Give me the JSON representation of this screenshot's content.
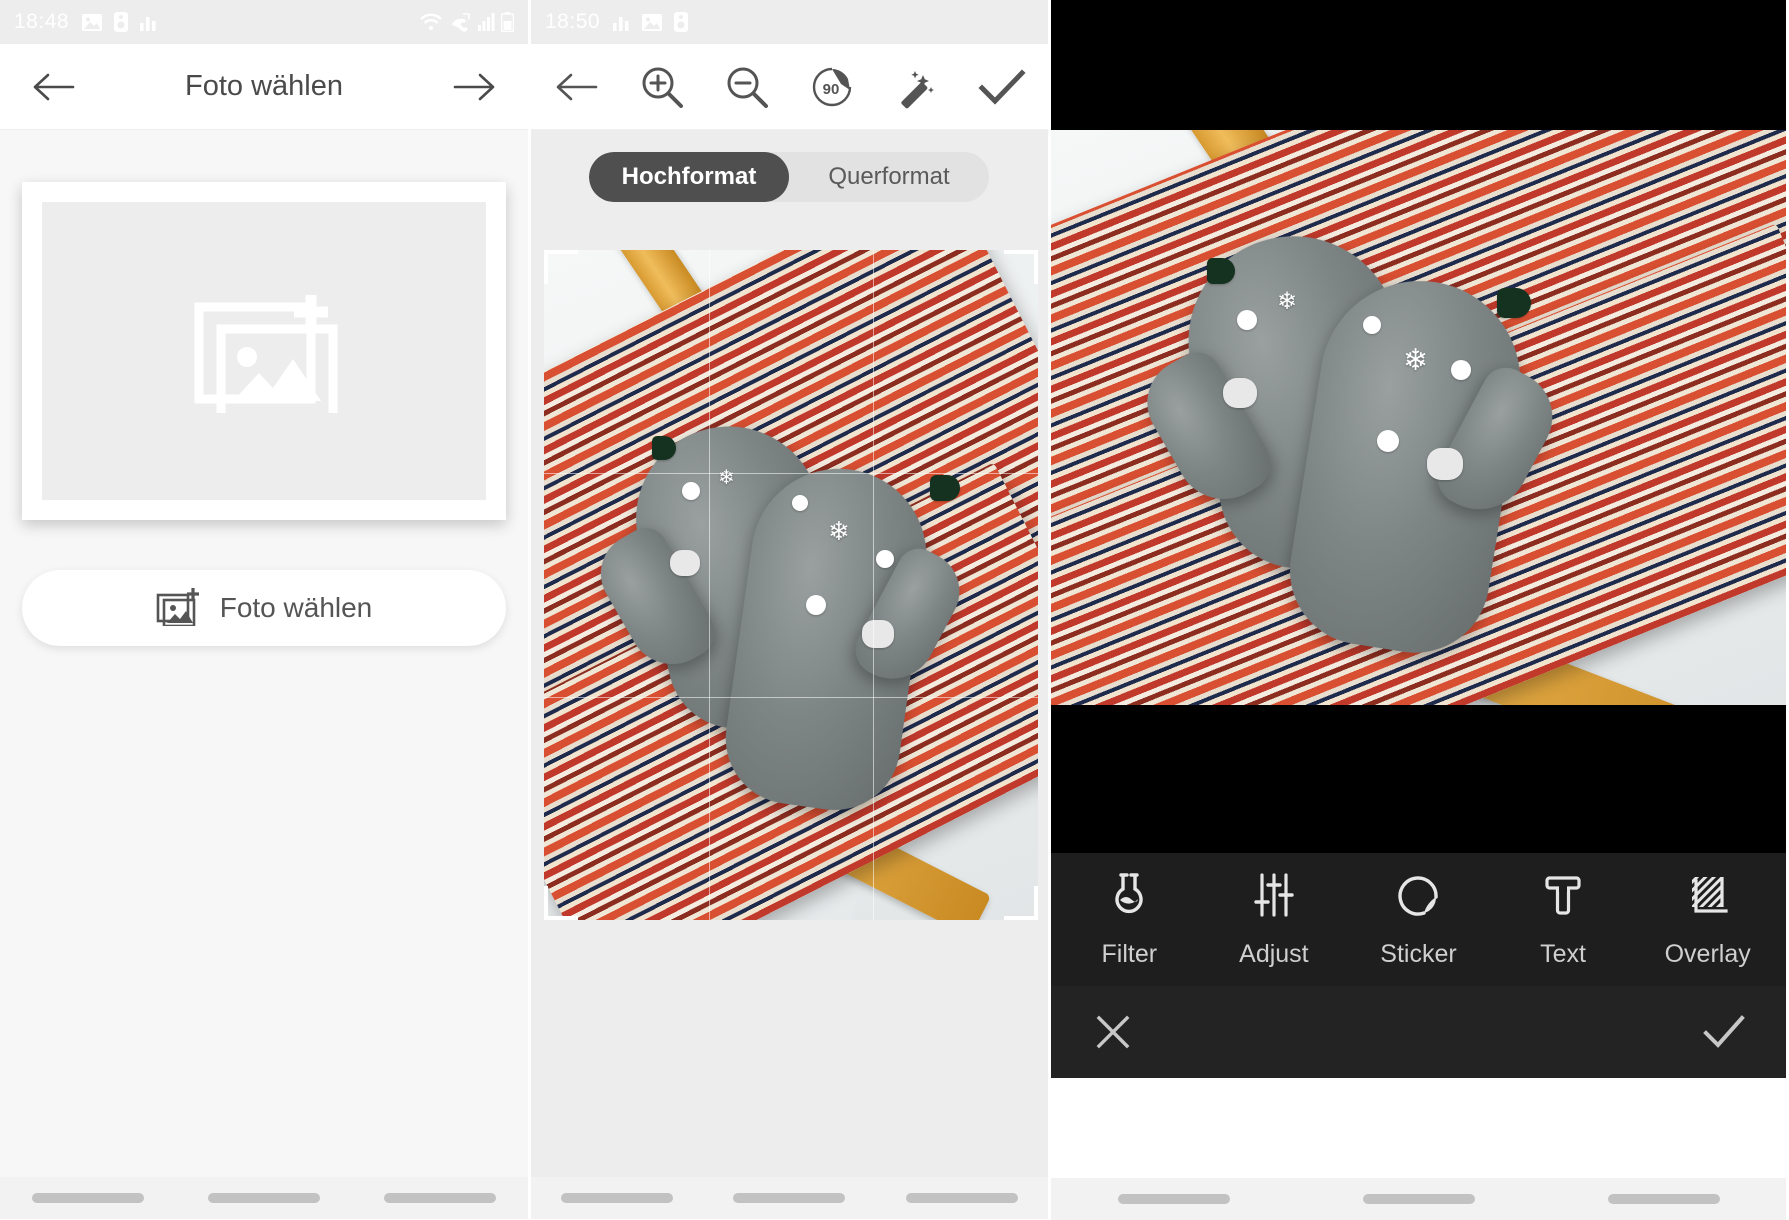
{
  "panel1": {
    "statusbar": {
      "time": "18:48",
      "icons_left": [
        "image-icon",
        "sim-icon",
        "signal-bars-icon"
      ],
      "icons_right": [
        "wifi-icon",
        "missed-call-icon",
        "cellular-icon",
        "battery-icon"
      ]
    },
    "appbar": {
      "back_icon": "arrow-left-icon",
      "title": "Foto wählen",
      "forward_icon": "arrow-right-icon"
    },
    "placeholder": {
      "icon": "add-photo-icon"
    },
    "pick_button": {
      "icon": "add-photo-icon",
      "label": "Foto wählen"
    }
  },
  "panel2": {
    "statusbar": {
      "time": "18:50",
      "icons_left": [
        "signal-bars-icon",
        "image-icon",
        "sim-icon"
      ],
      "icons_right": []
    },
    "toolbar": {
      "back_icon": "arrow-left-icon",
      "zoom_in_icon": "zoom-in-icon",
      "zoom_out_icon": "zoom-out-icon",
      "rotate_label": "90",
      "rotate_icon": "rotate-90-icon",
      "enhance_icon": "magic-wand-icon",
      "confirm_icon": "check-icon"
    },
    "segmented": {
      "options": [
        "Hochformat",
        "Querformat"
      ],
      "selected": "Hochformat",
      "selected_index": 0
    }
  },
  "panel3": {
    "tools": [
      {
        "label": "Filter",
        "icon": "flask-filter-icon"
      },
      {
        "label": "Adjust",
        "icon": "sliders-icon"
      },
      {
        "label": "Sticker",
        "icon": "sticker-icon"
      },
      {
        "label": "Text",
        "icon": "text-t-icon"
      },
      {
        "label": "Overlay",
        "icon": "overlay-hatch-icon"
      }
    ],
    "bottom": {
      "cancel_icon": "close-x-icon",
      "confirm_icon": "check-icon"
    }
  },
  "colors": {
    "status_bar_bg": "#ededed",
    "body_bg": "#f7f7f7",
    "segment_active_bg": "#4f4f4f",
    "segment_track_bg": "#e2e2e2",
    "tools_bar_bg": "#1e1e1e",
    "bottom_bar_bg": "#232323",
    "icon_gray": "#545454"
  }
}
